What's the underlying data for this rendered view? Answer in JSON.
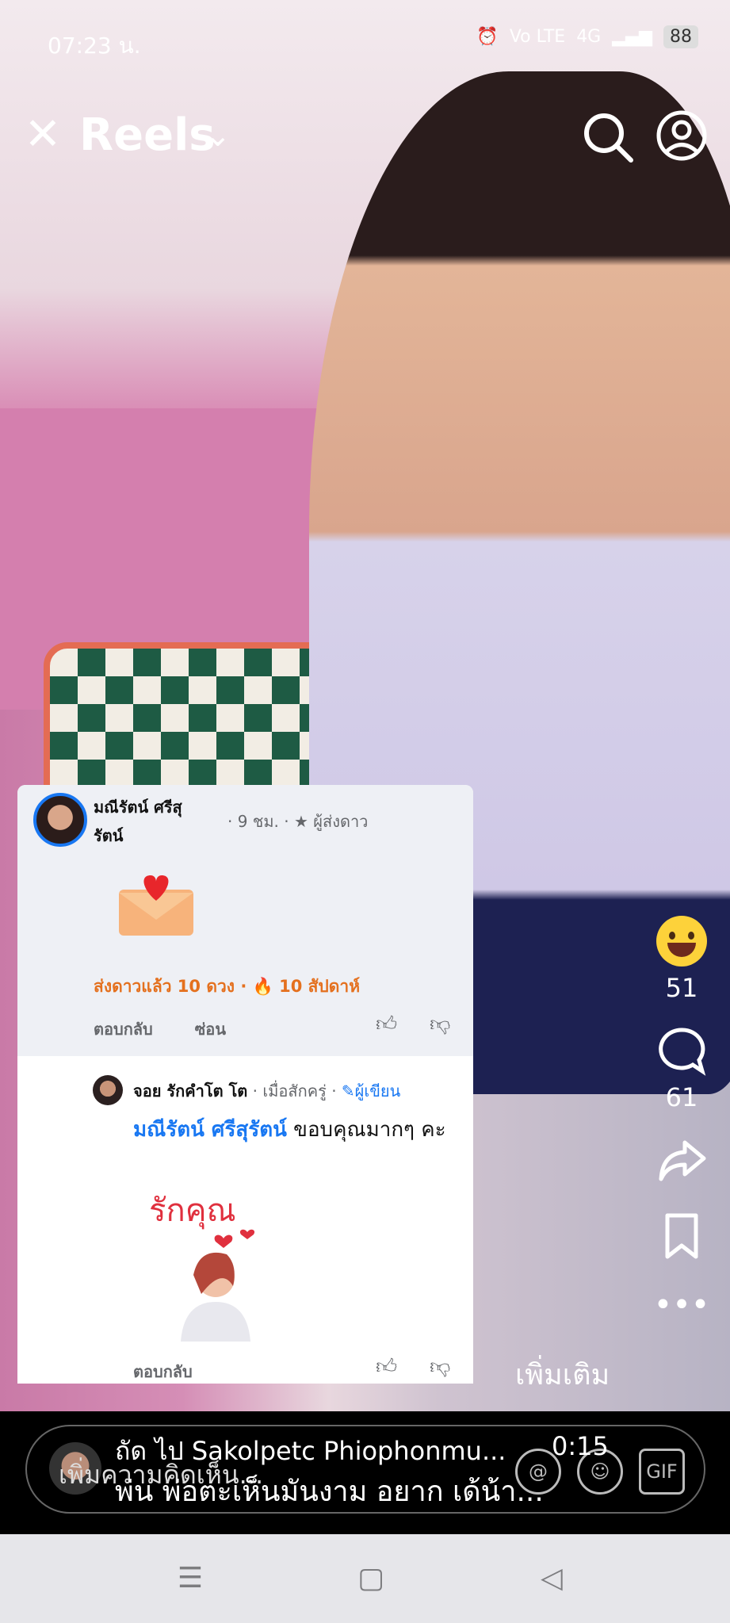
{
  "status_bar": {
    "time": "07:23 น.",
    "network": "Vo LTE",
    "signal": "4G",
    "battery": "88"
  },
  "header": {
    "close_label": "✕",
    "title": "Reels"
  },
  "actions": {
    "reaction_count": "51",
    "comment_count": "61"
  },
  "comment": {
    "author": "มณีรัตน์ ศรีสุรัตน์",
    "meta": "· 9 ชม. · ★ ผู้ส่งดาว",
    "stats": "ส่งดาวแล้ว 10 ดวง · 🔥 10 สัปดาห์",
    "reply_label": "ตอบกลับ",
    "hide_label": "ซ่อน"
  },
  "reply": {
    "author": "จอย รักคำโต โต",
    "time": "· เมื่อสักครู่ ·",
    "badge": "✎ผู้เขียน",
    "mention": "มณีรัตน์ ศรีสุรัตน์",
    "text": " ขอบคุณมากๆ คะ",
    "sticker_text": "รักคุณ",
    "reply_label": "ตอบกลับ"
  },
  "caption": {
    "see_more": "เพิ่มเติม"
  },
  "up_next": {
    "label": "ถัด ไป Sakolpetc Phiophonmu...",
    "duration": "0:15",
    "caption": "พ่น พ่อตะเห็นมันงาม อยาก เด้น้า..."
  },
  "comment_bar": {
    "placeholder": "เพิ่มความคิดเห็น..."
  }
}
